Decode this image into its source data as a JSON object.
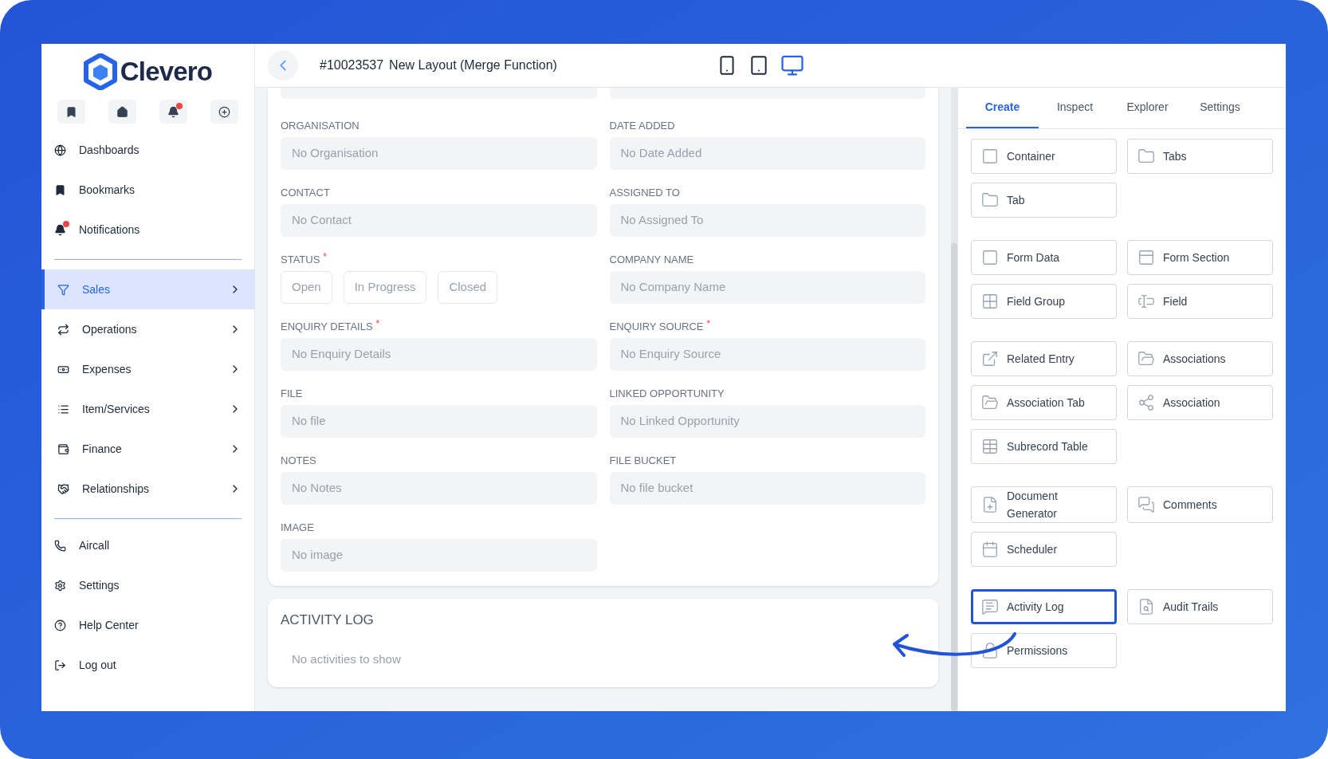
{
  "brand": {
    "name": "Clevero"
  },
  "quick_actions": [
    {
      "badge": false
    },
    {
      "badge": false
    },
    {
      "badge": true
    },
    {
      "badge": false
    }
  ],
  "nav_top": [
    {
      "label": "Dashboards",
      "badge": false
    },
    {
      "label": "Bookmarks",
      "badge": false
    },
    {
      "label": "Notifications",
      "badge": true
    }
  ],
  "modules": [
    {
      "label": "Sales",
      "selected": true
    },
    {
      "label": "Operations",
      "selected": false
    },
    {
      "label": "Expenses",
      "selected": false
    },
    {
      "label": "Item/Services",
      "selected": false
    },
    {
      "label": "Finance",
      "selected": false
    },
    {
      "label": "Relationships",
      "selected": false
    }
  ],
  "nav_bottom": [
    {
      "label": "Aircall"
    },
    {
      "label": "Settings"
    },
    {
      "label": "Help Center"
    },
    {
      "label": "Log out"
    }
  ],
  "header": {
    "record_id": "#10023537",
    "title": "New Layout (Merge Function)"
  },
  "devices": [
    {
      "selected": false
    },
    {
      "selected": false
    },
    {
      "selected": true
    }
  ],
  "form": {
    "rows": [
      [
        {
          "label": "ORGANISATION",
          "kind": "field",
          "placeholder": "No Organisation"
        },
        {
          "label": "DATE ADDED",
          "kind": "field",
          "placeholder": "No Date Added"
        }
      ],
      [
        {
          "label": "CONTACT",
          "kind": "field",
          "placeholder": "No Contact"
        },
        {
          "label": "ASSIGNED TO",
          "kind": "field",
          "placeholder": "No Assigned To"
        }
      ],
      [
        {
          "label": "STATUS",
          "required_mark": "*",
          "kind": "options",
          "options": [
            {
              "label": "Open",
              "selected": false
            },
            {
              "label": "In Progress",
              "selected": false
            },
            {
              "label": "Closed",
              "selected": false
            }
          ]
        },
        {
          "label": "COMPANY NAME",
          "kind": "field",
          "placeholder": "No Company Name"
        }
      ],
      [
        {
          "label": "ENQUIRY DETAILS",
          "required_mark": "*",
          "kind": "field",
          "placeholder": "No Enquiry Details"
        },
        {
          "label": "ENQUIRY SOURCE",
          "required_mark": "*",
          "kind": "field",
          "placeholder": "No Enquiry Source"
        }
      ],
      [
        {
          "label": "FILE",
          "kind": "field",
          "placeholder": "No file"
        },
        {
          "label": "LINKED OPPORTUNITY",
          "kind": "field",
          "placeholder": "No Linked Opportunity"
        }
      ],
      [
        {
          "label": "NOTES",
          "kind": "field",
          "placeholder": "No Notes"
        },
        {
          "label": "FILE BUCKET",
          "kind": "field",
          "placeholder": "No file bucket"
        }
      ],
      [
        {
          "label": "IMAGE",
          "kind": "field",
          "placeholder": "No image"
        }
      ]
    ]
  },
  "activity_log": {
    "title": "ACTIVITY LOG",
    "empty_text": "No activities to show"
  },
  "panel_tabs": [
    {
      "label": "Create",
      "selected": true
    },
    {
      "label": "Inspect",
      "selected": false
    },
    {
      "label": "Explorer",
      "selected": false
    },
    {
      "label": "Settings",
      "selected": false
    }
  ],
  "create_groups": [
    [
      {
        "label": "Container",
        "highlighted": false
      },
      {
        "label": "Tabs",
        "highlighted": false
      },
      {
        "label": "Tab",
        "highlighted": false
      }
    ],
    [
      {
        "label": "Form Data",
        "highlighted": false
      },
      {
        "label": "Form Section",
        "highlighted": false
      },
      {
        "label": "Field Group",
        "highlighted": false
      },
      {
        "label": "Field",
        "highlighted": false
      }
    ],
    [
      {
        "label": "Related Entry",
        "highlighted": false
      },
      {
        "label": "Associations",
        "highlighted": false
      },
      {
        "label": "Association Tab",
        "highlighted": false
      },
      {
        "label": "Association",
        "highlighted": false
      },
      {
        "label": "Subrecord Table",
        "highlighted": false
      }
    ],
    [
      {
        "label": "Document Generator",
        "highlighted": false
      },
      {
        "label": "Comments",
        "highlighted": false
      },
      {
        "label": "Scheduler",
        "highlighted": false
      }
    ],
    [
      {
        "label": "Activity Log",
        "highlighted": true
      },
      {
        "label": "Audit Trails",
        "highlighted": false
      },
      {
        "label": "Permissions",
        "highlighted": false
      }
    ]
  ]
}
